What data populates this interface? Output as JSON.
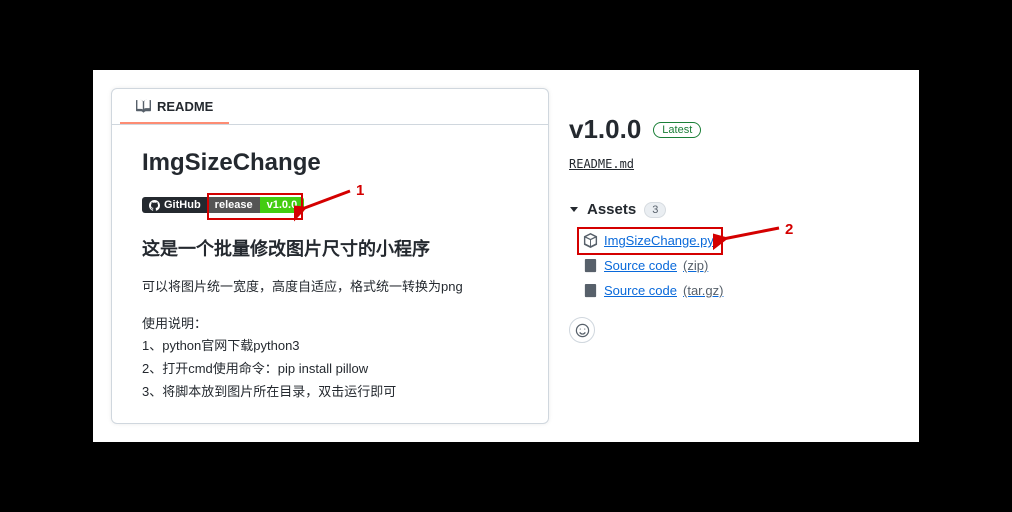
{
  "readme": {
    "tab_label": "README",
    "title": "ImgSizeChange",
    "badge_github": "GitHub",
    "badge_release": "release",
    "badge_version": "v1.0.0",
    "h2": "这是一个批量修改图片尺寸的小程序",
    "desc": "可以将图片统一宽度，高度自适应，格式统一转换为png",
    "usage_title": "使用说明：",
    "usage_1": "1、python官网下载python3",
    "usage_2": "2、打开cmd使用命令：pip install pillow",
    "usage_3": "3、将脚本放到图片所在目录，双击运行即可"
  },
  "release": {
    "version": "v1.0.0",
    "latest": "Latest",
    "readme_file": "README.md",
    "assets_title": "Assets",
    "assets_count": "3",
    "assets": [
      {
        "name": "ImgSizeChange.py",
        "suffix": ""
      },
      {
        "name": "Source code",
        "suffix": "(zip)"
      },
      {
        "name": "Source code",
        "suffix": "(tar.gz)"
      }
    ]
  },
  "annotations": {
    "label_1": "1",
    "label_2": "2"
  }
}
